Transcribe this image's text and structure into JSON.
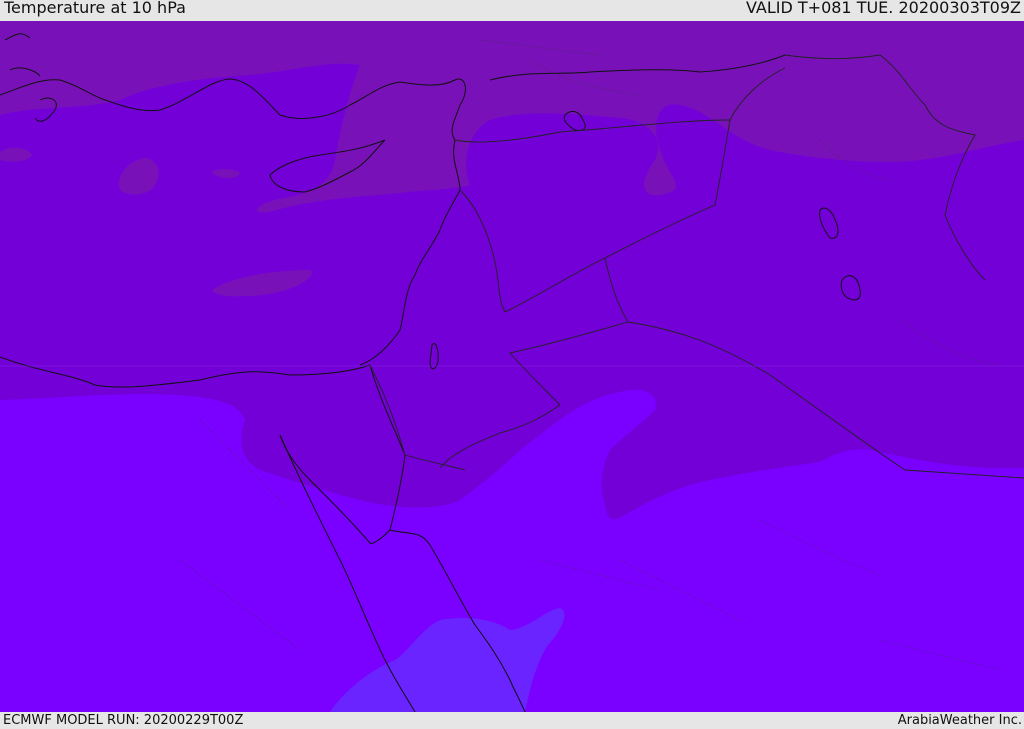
{
  "header": {
    "title": "Temperature at 10 hPa",
    "valid": "VALID T+081 TUE. 20200303T09Z"
  },
  "footer": {
    "model_run": "ECMWF MODEL RUN: 20200229T00Z",
    "credit": "ArabiaWeather Inc."
  },
  "map": {
    "region": "Eastern Mediterranean / Middle East",
    "field": "temperature",
    "colors": {
      "band_warmest": "#7812b8",
      "band_warm": "#7400d8",
      "band_mid": "#7500f0",
      "band_cool": "#7a00ff",
      "band_coolest": "#6a24ff",
      "coastline": "#111111",
      "border": "#222222"
    }
  }
}
